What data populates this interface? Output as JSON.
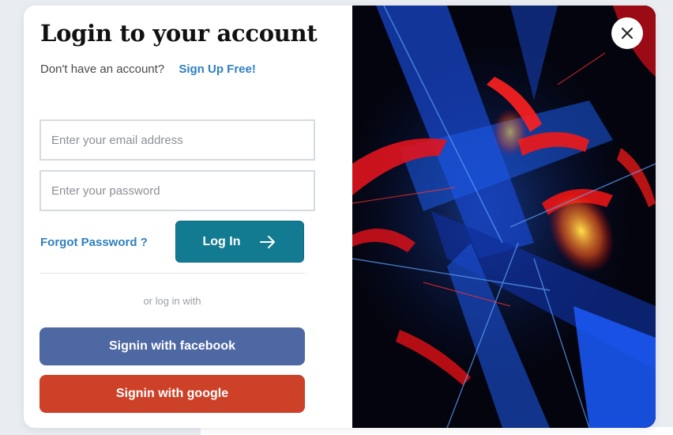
{
  "modal": {
    "title": "Login to your account",
    "signup_prompt": "Don't have an account?",
    "signup_link": "Sign Up Free!",
    "email_placeholder": "Enter your email address",
    "password_placeholder": "Enter your password",
    "forgot_password": "Forgot Password ?",
    "login_button": "Log In",
    "or_text": "or log in with",
    "facebook_button": "Signin with facebook",
    "google_button": "Signin with google"
  },
  "icons": {
    "close": "close-icon",
    "login_arrow": "arrow-right-icon"
  },
  "colors": {
    "link": "#2f7fc1",
    "login_button": "#137b91",
    "facebook": "#4e68a3",
    "google": "#cd4128",
    "close_button": "#ffffff"
  }
}
